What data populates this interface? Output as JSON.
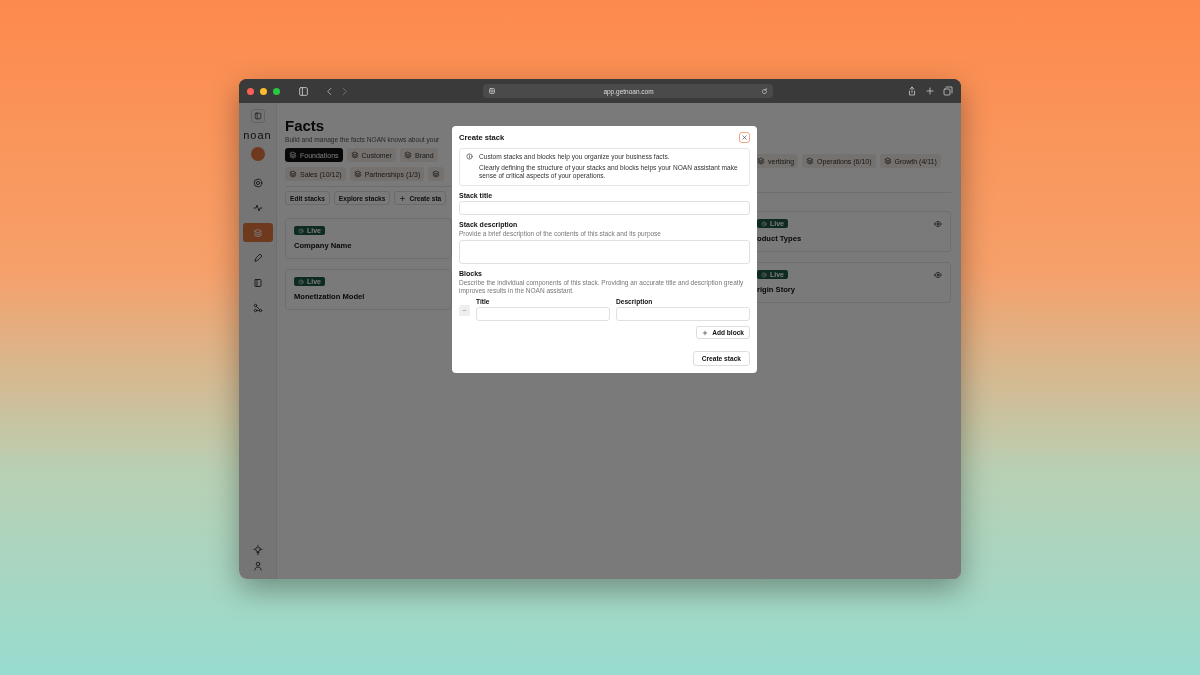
{
  "browser": {
    "url": "app.getnoan.com"
  },
  "sidebar": {
    "logo": "noan",
    "items": [
      {
        "selected": false
      },
      {
        "selected": false
      },
      {
        "selected": true
      },
      {
        "selected": false
      },
      {
        "selected": false
      },
      {
        "selected": false
      }
    ]
  },
  "page": {
    "title": "Facts",
    "subtitle": "Build and manage the facts NOAN knows about your"
  },
  "tabs": {
    "left": [
      [
        {
          "label": "Foundations",
          "selected": true
        },
        {
          "label": "Customer",
          "selected": false
        },
        {
          "label": "Brand",
          "selected": false
        }
      ],
      [
        {
          "label": "Sales (10/12)",
          "selected": false
        },
        {
          "label": "Partnerships (1/3)",
          "selected": false
        },
        {
          "selected": false
        }
      ]
    ],
    "right": [
      {
        "label": "vertising",
        "selected": false
      },
      {
        "label": "Operations (6/10)",
        "selected": false
      },
      {
        "label": "Growth (4/11)",
        "selected": false
      }
    ]
  },
  "actions": [
    {
      "label": "Edit stacks",
      "kind": "plain"
    },
    {
      "label": "Explore stacks",
      "kind": "plain"
    },
    {
      "label": "Create sta",
      "kind": "add"
    }
  ],
  "cards_left": [
    {
      "status": "Live",
      "title": "Company Name"
    },
    {
      "status": "Live",
      "title": "Monetization Model"
    }
  ],
  "cards_right": [
    {
      "status": "Live",
      "title": "oduct Types"
    },
    {
      "status": "Live",
      "title": "rigin Story"
    }
  ],
  "modal": {
    "title": "Create stack",
    "info": [
      "Custom stacks and blocks help you organize your business facts.",
      "Clearly defining the structure of your stacks and blocks helps your NOAN assistant make sense of critical aspects of your operations."
    ],
    "fields": [
      {
        "label": "Stack title",
        "kind": "input"
      },
      {
        "label": "Stack description",
        "description": "Provide a brief description of the contents of this stack and its purpose",
        "kind": "textarea"
      }
    ],
    "blocks": {
      "label": "Blocks",
      "description": "Describe the individual components of this stack. Providing an accurate title and description greatly improves results in the NOAN assistant.",
      "columns": [
        "Title",
        "Description"
      ],
      "add_button": "Add block"
    },
    "submit": "Create stack"
  }
}
